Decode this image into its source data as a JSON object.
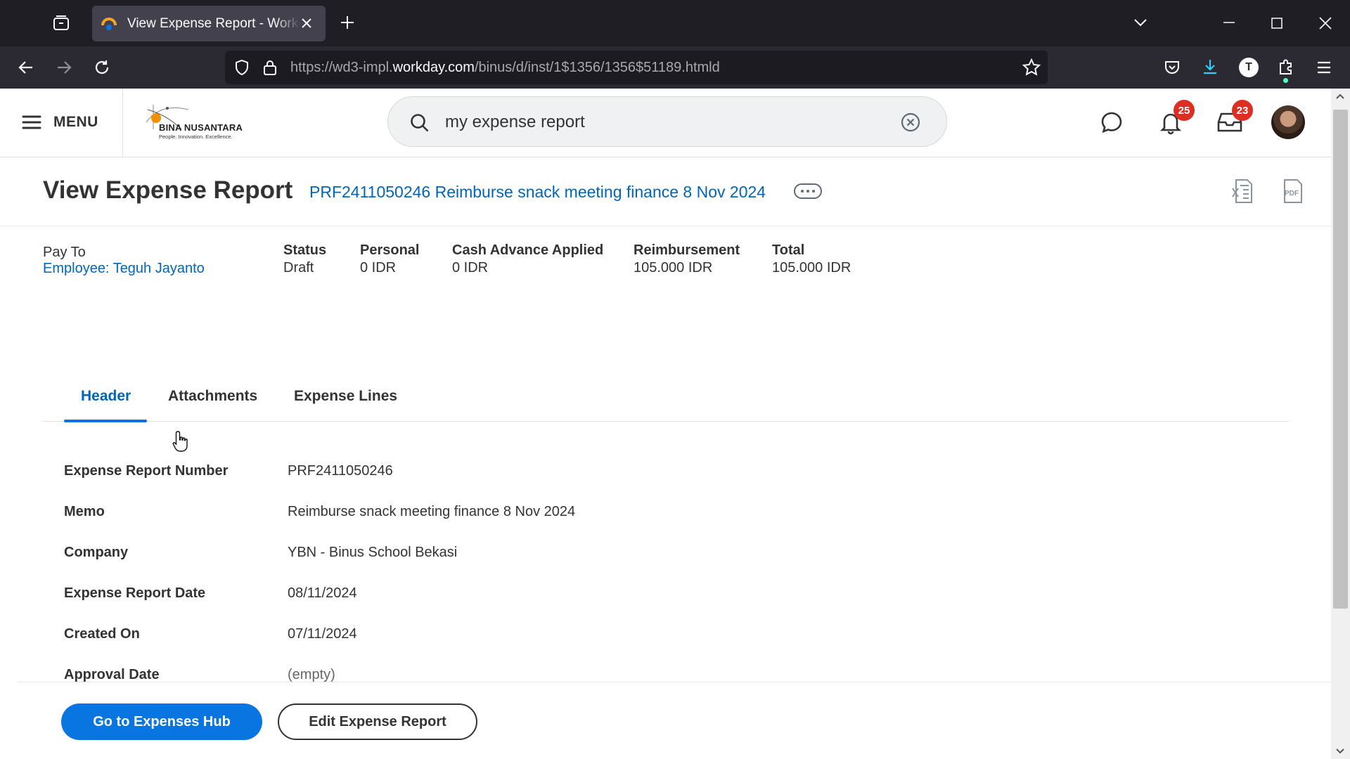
{
  "browser": {
    "tab_title": "View Expense Report - Workday",
    "url_prefix": "https://wd3-impl.",
    "url_host": "workday.com",
    "url_path": "/binus/d/inst/1$1356/1356$51189.htmld"
  },
  "header": {
    "menu_label": "MENU",
    "logo_name": "BINA NUSANTARA",
    "logo_tagline": "People.  Innovation.  Excellence.",
    "search_value": "my expense report",
    "notifications_count": "25",
    "inbox_count": "23"
  },
  "page": {
    "title": "View Expense Report",
    "record": "PRF2411050246 Reimburse snack meeting finance 8 Nov 2024"
  },
  "summary": {
    "pay_to_label": "Pay To",
    "pay_to_value": "Employee: Teguh Jayanto",
    "status_label": "Status",
    "status_value": "Draft",
    "personal_label": "Personal",
    "personal_value": "0 IDR",
    "cash_advance_label": "Cash Advance Applied",
    "cash_advance_value": "0 IDR",
    "reimbursement_label": "Reimbursement",
    "reimbursement_value": "105.000 IDR",
    "total_label": "Total",
    "total_value": "105.000 IDR"
  },
  "tabs": [
    {
      "label": "Header",
      "active": true
    },
    {
      "label": "Attachments",
      "active": false
    },
    {
      "label": "Expense Lines",
      "active": false
    }
  ],
  "fields": [
    {
      "label": "Expense Report Number",
      "value": "PRF2411050246"
    },
    {
      "label": "Memo",
      "value": "Reimburse snack meeting finance 8 Nov 2024"
    },
    {
      "label": "Company",
      "value": "YBN - Binus School Bekasi"
    },
    {
      "label": "Expense Report Date",
      "value": "08/11/2024"
    },
    {
      "label": "Created On",
      "value": "07/11/2024"
    },
    {
      "label": "Approval Date",
      "value": "(empty)"
    }
  ],
  "footer": {
    "hub_button": "Go to Expenses Hub",
    "edit_button": "Edit Expense Report"
  },
  "colors": {
    "link_blue": "#0066b9",
    "primary_button": "#0875e1",
    "badge_red": "#de2e21"
  }
}
